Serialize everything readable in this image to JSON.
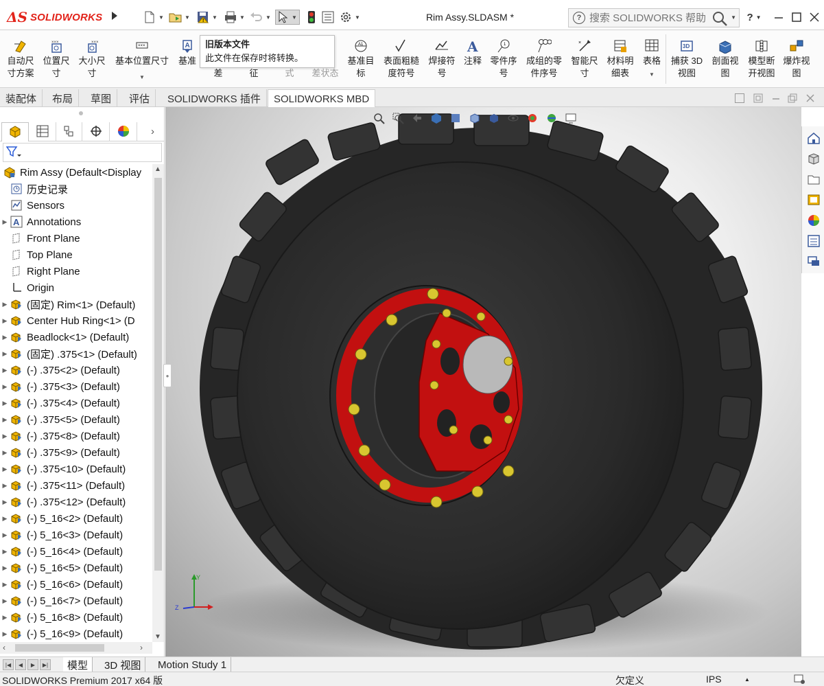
{
  "app": {
    "logo_text": "SOLIDWORKS",
    "document_title": "Rim Assy.SLDASM *",
    "search_placeholder": "搜索 SOLIDWORKS 帮助",
    "help_label": "?",
    "brand_color": "#e2231a"
  },
  "ribbon": {
    "buttons": [
      {
        "line1": "自动尺",
        "line2": "寸方案",
        "icon": "auto-dimension-icon"
      },
      {
        "line1": "位置尺",
        "line2": "寸",
        "icon": "location-dimension-icon"
      },
      {
        "line1": "大小尺",
        "line2": "寸",
        "icon": "size-dimension-icon"
      },
      {
        "line1": "基本位置尺寸",
        "line2": "",
        "icon": "basic-location-dimension-icon"
      },
      {
        "line1": "基准",
        "line2": "",
        "icon": "datum-icon"
      },
      {
        "line1": "",
        "line2": "差",
        "icon": "tolerance-icon"
      },
      {
        "line1": "",
        "line2": "征",
        "icon": "feature-icon"
      },
      {
        "line1": "",
        "line2": "式",
        "icon": "style-icon"
      },
      {
        "line1": "",
        "line2": "差状态",
        "icon": "tolerance-status-icon"
      },
      {
        "line1": "基准目",
        "line2": "标",
        "icon": "datum-target-icon"
      },
      {
        "line1": "表面粗糙",
        "line2": "度符号",
        "icon": "surface-finish-icon"
      },
      {
        "line1": "焊接符",
        "line2": "号",
        "icon": "weld-symbol-icon"
      },
      {
        "line1": "注释",
        "line2": "",
        "icon": "note-icon"
      },
      {
        "line1": "零件序",
        "line2": "号",
        "icon": "balloon-icon"
      },
      {
        "line1": "成组的零",
        "line2": "件序号",
        "icon": "stacked-balloon-icon"
      },
      {
        "line1": "智能尺",
        "line2": "寸",
        "icon": "smart-dimension-icon"
      },
      {
        "line1": "材料明",
        "line2": "细表",
        "icon": "bom-icon"
      },
      {
        "line1": "表格",
        "line2": "",
        "icon": "table-icon"
      },
      {
        "line1": "捕获 3D",
        "line2": "视图",
        "icon": "capture-3d-view-icon"
      },
      {
        "line1": "剖面视",
        "line2": "图",
        "icon": "section-view-icon"
      },
      {
        "line1": "模型断",
        "line2": "开视图",
        "icon": "model-break-view-icon"
      },
      {
        "line1": "爆炸视",
        "line2": "图",
        "icon": "exploded-view-icon"
      }
    ]
  },
  "tooltip": {
    "title": "旧版本文件",
    "body": "此文件在保存时将转换。"
  },
  "command_tabs": [
    "装配体",
    "布局",
    "草图",
    "评估",
    "SOLIDWORKS 插件",
    "SOLIDWORKS MBD"
  ],
  "active_command_tab": "SOLIDWORKS MBD",
  "feature_tree": {
    "root": "Rim Assy  (Default<Display",
    "items": [
      {
        "label": "历史记录",
        "icon": "history-icon",
        "expandable": false
      },
      {
        "label": "Sensors",
        "icon": "sensors-icon",
        "expandable": false
      },
      {
        "label": "Annotations",
        "icon": "annotations-icon",
        "expandable": true
      },
      {
        "label": "Front Plane",
        "icon": "plane-icon",
        "expandable": false
      },
      {
        "label": "Top Plane",
        "icon": "plane-icon",
        "expandable": false
      },
      {
        "label": "Right Plane",
        "icon": "plane-icon",
        "expandable": false
      },
      {
        "label": "Origin",
        "icon": "origin-icon",
        "expandable": false
      },
      {
        "label": "(固定) Rim<1> (Default)",
        "icon": "part-icon",
        "expandable": true
      },
      {
        "label": "Center Hub Ring<1> (D",
        "icon": "part-icon",
        "expandable": true
      },
      {
        "label": "Beadlock<1> (Default)",
        "icon": "part-icon",
        "expandable": true
      },
      {
        "label": "(固定) .375<1> (Default)",
        "icon": "part-icon",
        "expandable": true
      },
      {
        "label": "(-) .375<2> (Default)",
        "icon": "part-icon",
        "expandable": true
      },
      {
        "label": "(-) .375<3> (Default)",
        "icon": "part-icon",
        "expandable": true
      },
      {
        "label": "(-) .375<4> (Default)",
        "icon": "part-icon",
        "expandable": true
      },
      {
        "label": "(-) .375<5> (Default)",
        "icon": "part-icon",
        "expandable": true
      },
      {
        "label": "(-) .375<8> (Default)",
        "icon": "part-icon",
        "expandable": true
      },
      {
        "label": "(-) .375<9> (Default)",
        "icon": "part-icon",
        "expandable": true
      },
      {
        "label": "(-) .375<10> (Default)",
        "icon": "part-icon",
        "expandable": true
      },
      {
        "label": "(-) .375<11> (Default)",
        "icon": "part-icon",
        "expandable": true
      },
      {
        "label": "(-) .375<12> (Default)",
        "icon": "part-icon",
        "expandable": true
      },
      {
        "label": "(-) 5_16<2> (Default)",
        "icon": "part-icon",
        "expandable": true
      },
      {
        "label": "(-) 5_16<3> (Default)",
        "icon": "part-icon",
        "expandable": true
      },
      {
        "label": "(-) 5_16<4> (Default)",
        "icon": "part-icon",
        "expandable": true
      },
      {
        "label": "(-) 5_16<5> (Default)",
        "icon": "part-icon",
        "expandable": true
      },
      {
        "label": "(-) 5_16<6> (Default)",
        "icon": "part-icon",
        "expandable": true
      },
      {
        "label": "(-) 5_16<7> (Default)",
        "icon": "part-icon",
        "expandable": true
      },
      {
        "label": "(-) 5_16<8> (Default)",
        "icon": "part-icon",
        "expandable": true
      },
      {
        "label": "(-) 5_16<9> (Default)",
        "icon": "part-icon",
        "expandable": true
      }
    ]
  },
  "bottom_tabs": [
    "模型",
    "3D 视图",
    "Motion Study 1"
  ],
  "active_bottom_tab": "模型",
  "status_bar": {
    "product": "SOLIDWORKS Premium 2017 x64 版",
    "definition_state": "欠定义",
    "units": "IPS"
  },
  "colors": {
    "rim_red": "#c21010",
    "tire_dark": "#2a2a2a",
    "bolt_yellow": "#d8c630"
  }
}
